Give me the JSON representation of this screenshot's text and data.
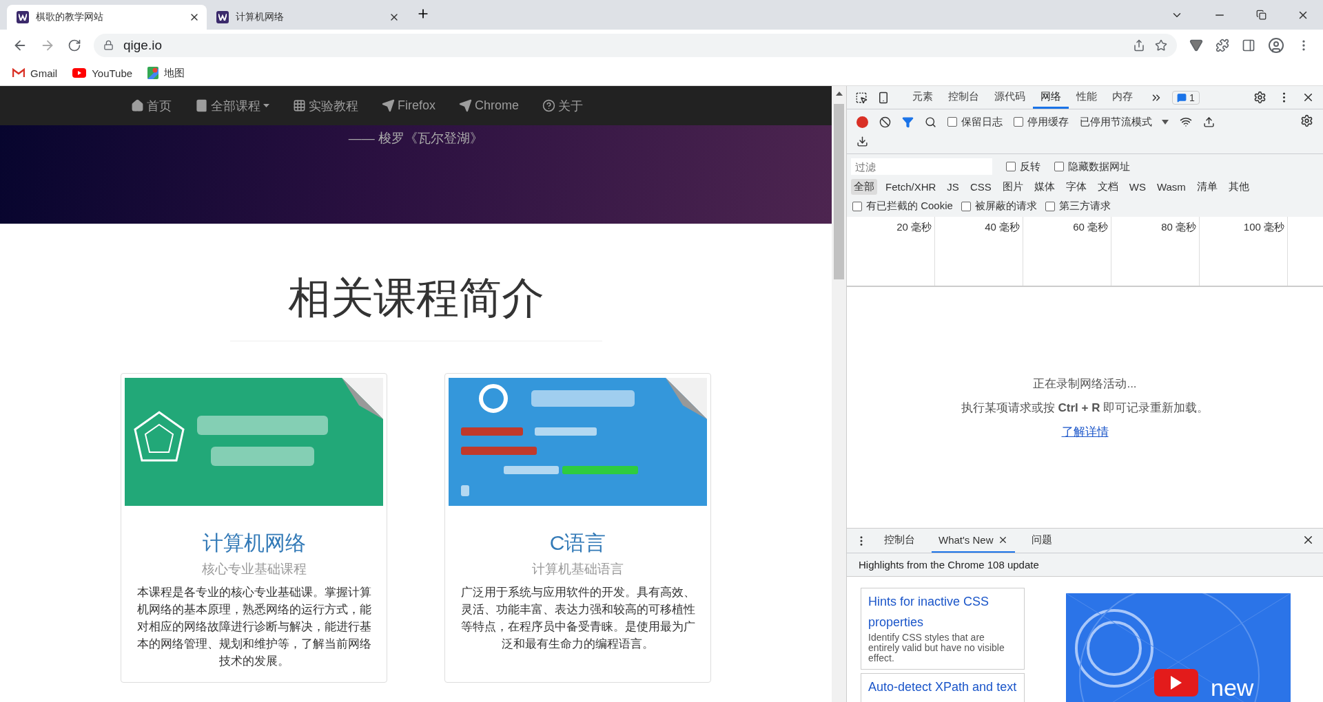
{
  "browser": {
    "tabs": [
      {
        "title": "棋歌的教学网站",
        "selected": true
      },
      {
        "title": "计算机网络",
        "selected": false
      }
    ],
    "address": "qige.io",
    "bookmarks": [
      "Gmail",
      "YouTube",
      "地图"
    ]
  },
  "page": {
    "nav": [
      {
        "label": "首页",
        "dropdown": false
      },
      {
        "label": "全部课程",
        "dropdown": true
      },
      {
        "label": "实验教程",
        "dropdown": false
      },
      {
        "label": "Firefox",
        "dropdown": false
      },
      {
        "label": "Chrome",
        "dropdown": false
      },
      {
        "label": "关于",
        "dropdown": false
      }
    ],
    "hero": {
      "quote_source": "—— 梭罗《瓦尔登湖》"
    },
    "section_title": "相关课程简介",
    "cards": [
      {
        "title": "计算机网络",
        "subtitle": "核心专业基础课程",
        "description": "本课程是各专业的核心专业基础课。掌握计算机网络的基本原理，熟悉网络的运行方式，能对相应的网络故障进行诊断与解决，能进行基本的网络管理、规划和维护等，了解当前网络技术的发展。"
      },
      {
        "title": "C语言",
        "subtitle": "计算机基础语言",
        "description": "广泛用于系统与应用软件的开发。具有高效、灵活、功能丰富、表达力强和较高的可移植性等特点，在程序员中备受青睐。是使用最为广泛和最有生命力的编程语言。"
      }
    ]
  },
  "devtools": {
    "panel_tabs": [
      {
        "label": "元素",
        "selected": false
      },
      {
        "label": "控制台",
        "selected": false
      },
      {
        "label": "源代码",
        "selected": false
      },
      {
        "label": "网络",
        "selected": true
      },
      {
        "label": "性能",
        "selected": false
      },
      {
        "label": "内存",
        "selected": false
      }
    ],
    "issues_count": "1",
    "recording": true,
    "toolbar_checkboxes": [
      {
        "label": "保留日志",
        "checked": false
      },
      {
        "label": "停用缓存",
        "checked": false
      }
    ],
    "throttle": "已停用节流模式",
    "filter": {
      "placeholder": "过滤"
    },
    "filter_checkboxes": [
      {
        "label": "反转",
        "checked": false
      },
      {
        "label": "隐藏数据网址",
        "checked": false
      }
    ],
    "type_filters": [
      {
        "label": "全部",
        "selected": true
      },
      {
        "label": "Fetch/XHR",
        "selected": false
      },
      {
        "label": "JS",
        "selected": false
      },
      {
        "label": "CSS",
        "selected": false
      },
      {
        "label": "图片",
        "selected": false
      },
      {
        "label": "媒体",
        "selected": false
      },
      {
        "label": "字体",
        "selected": false
      },
      {
        "label": "文档",
        "selected": false
      },
      {
        "label": "WS",
        "selected": false
      },
      {
        "label": "Wasm",
        "selected": false
      },
      {
        "label": "清单",
        "selected": false
      },
      {
        "label": "其他",
        "selected": false
      }
    ],
    "request_checkboxes": [
      {
        "label": "有已拦截的 Cookie",
        "checked": false
      },
      {
        "label": "被屏蔽的请求",
        "checked": false
      },
      {
        "label": "第三方请求",
        "checked": false
      }
    ],
    "timeline_ticks": [
      "20 毫秒",
      "40 毫秒",
      "60 毫秒",
      "80 毫秒",
      "100 毫秒"
    ],
    "empty": {
      "status": "正在录制网络活动...",
      "hint": "执行某项请求或按 **Ctrl + R** 即可记录重新加载。",
      "link": "了解详情"
    },
    "drawer": {
      "tabs": [
        {
          "label": "控制台",
          "selected": false,
          "closable": false
        },
        {
          "label": "What's New",
          "selected": true,
          "closable": true
        },
        {
          "label": "问题",
          "selected": false,
          "closable": false
        }
      ],
      "header": "Highlights from the Chrome 108 update",
      "articles": [
        {
          "title": "Hints for inactive CSS properties",
          "description": "Identify CSS styles that are entirely valid but have no visible effect."
        },
        {
          "title": "Auto-detect XPath and text"
        }
      ],
      "video": {
        "kind": "picture",
        "caption": "new"
      }
    }
  }
}
